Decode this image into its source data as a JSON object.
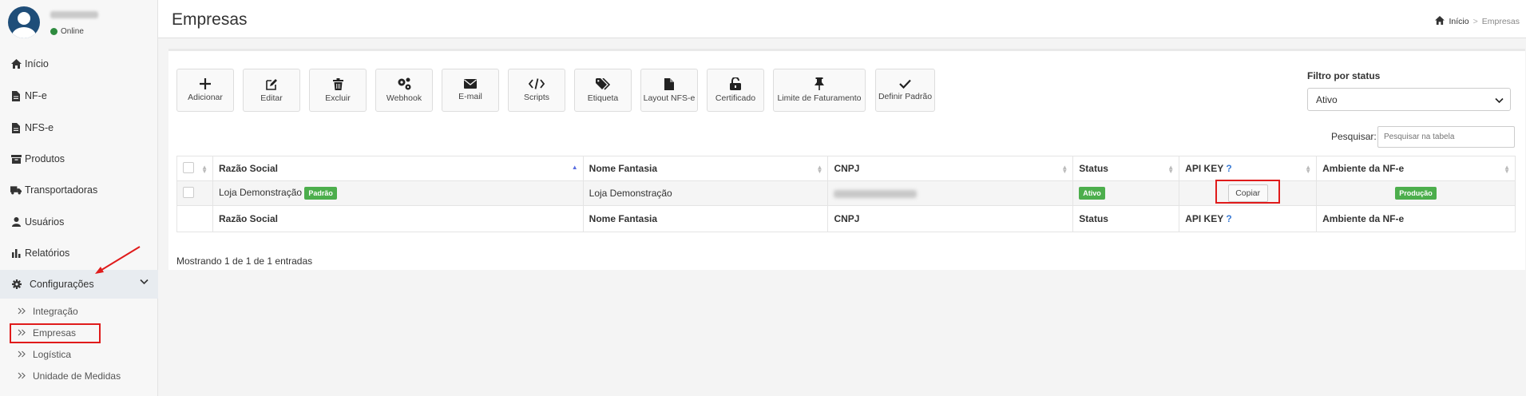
{
  "user": {
    "name": "",
    "status": "Online"
  },
  "sidebar": {
    "items": [
      {
        "label": "Início",
        "icon": "home-icon"
      },
      {
        "label": "NF-e",
        "icon": "file-icon"
      },
      {
        "label": "NFS-e",
        "icon": "file-icon"
      },
      {
        "label": "Produtos",
        "icon": "archive-icon"
      },
      {
        "label": "Transportadoras",
        "icon": "truck-icon"
      },
      {
        "label": "Usuários",
        "icon": "user-icon"
      },
      {
        "label": "Relatórios",
        "icon": "bar-chart-icon"
      },
      {
        "label": "Configurações",
        "icon": "gear-icon"
      }
    ],
    "submenu": [
      {
        "label": "Integração"
      },
      {
        "label": "Empresas"
      },
      {
        "label": "Logística"
      },
      {
        "label": "Unidade de Medidas"
      }
    ]
  },
  "header": {
    "title": "Empresas",
    "breadcrumb": {
      "home": "Início",
      "current": "Empresas"
    }
  },
  "toolbar": {
    "buttons": [
      {
        "label": "Adicionar",
        "icon": "plus-icon"
      },
      {
        "label": "Editar",
        "icon": "edit-icon"
      },
      {
        "label": "Excluir",
        "icon": "trash-icon"
      },
      {
        "label": "Webhook",
        "icon": "cogs-icon"
      },
      {
        "label": "E-mail",
        "icon": "envelope-icon"
      },
      {
        "label": "Scripts",
        "icon": "code-icon"
      },
      {
        "label": "Etiqueta",
        "icon": "tags-icon"
      },
      {
        "label": "Layout NFS-e",
        "icon": "document-icon"
      },
      {
        "label": "Certificado",
        "icon": "unlock-icon"
      },
      {
        "label": "Limite de Faturamento",
        "icon": "pin-icon"
      },
      {
        "label": "Definir Padrão",
        "icon": "check-icon"
      }
    ]
  },
  "filter": {
    "label": "Filtro por status",
    "selected": "Ativo"
  },
  "search": {
    "label": "Pesquisar:",
    "placeholder": "Pesquisar na tabela"
  },
  "table": {
    "columns": [
      "Razão Social",
      "Nome Fantasia",
      "CNPJ",
      "Status",
      "API KEY",
      "Ambiente da NF-e"
    ],
    "help_mark": "?",
    "rows": [
      {
        "razao_social": "Loja Demonstração",
        "badge": "Padrão",
        "nome_fantasia": "Loja Demonstração",
        "status": "Ativo",
        "api_key_button": "Copiar",
        "ambiente": "Produção"
      }
    ],
    "info": "Mostrando 1 de 1 de 1 entradas"
  },
  "colors": {
    "highlight": "#e01b1b",
    "badge_green": "#4cae4c",
    "online": "#2e8b3f",
    "avatar": "#1f4e79"
  }
}
